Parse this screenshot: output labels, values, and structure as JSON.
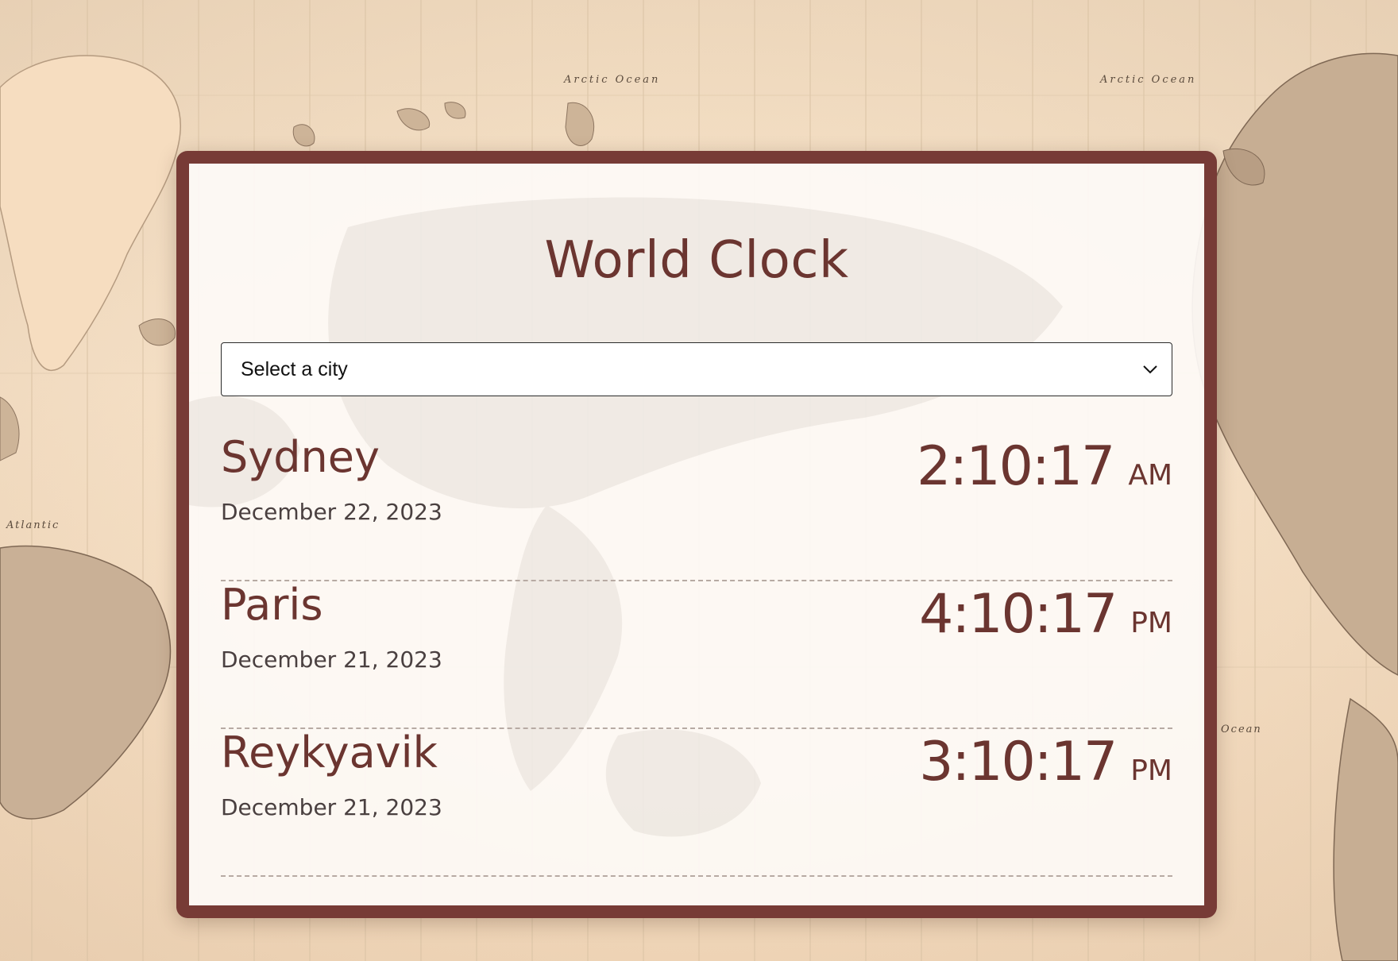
{
  "app": {
    "title": "World Clock"
  },
  "selector": {
    "placeholder": "Select a city",
    "icon": "chevron-down-icon"
  },
  "map_labels": [
    "Arctic Ocean",
    "Arctic Ocean",
    "Atlantic",
    "Ocean"
  ],
  "cities": [
    {
      "name": "Sydney",
      "date": "December 22, 2023",
      "time": "2:10:17",
      "period": "AM"
    },
    {
      "name": "Paris",
      "date": "December 21, 2023",
      "time": "4:10:17",
      "period": "PM"
    },
    {
      "name": "Reykyavik",
      "date": "December 21, 2023",
      "time": "3:10:17",
      "period": "PM"
    }
  ],
  "colors": {
    "accent": "#773b36",
    "text_primary": "#6b3530",
    "text_secondary": "#4a4040",
    "background": "#f4dcbf",
    "card": "#fdfaf6"
  }
}
